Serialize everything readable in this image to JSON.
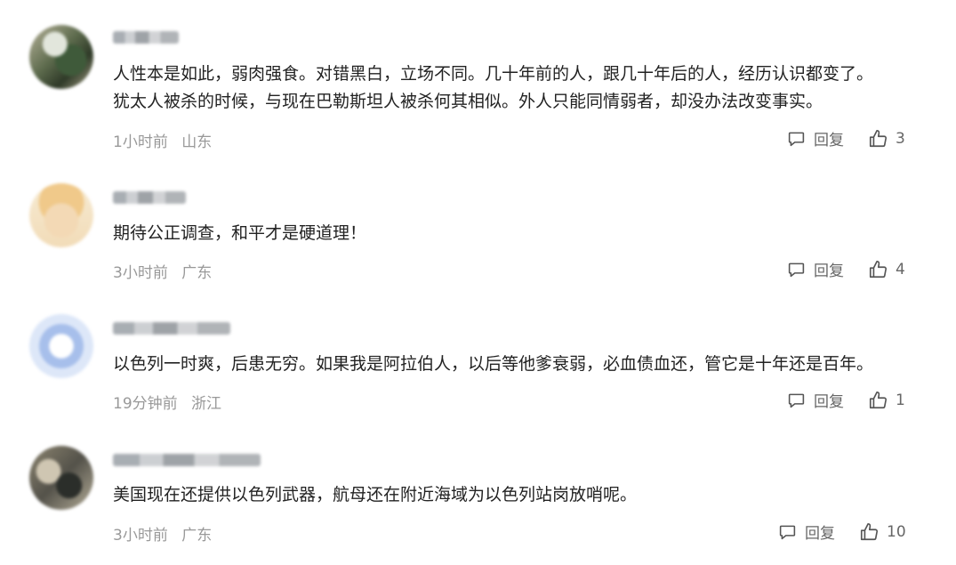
{
  "comments": [
    {
      "text_lines": [
        "人性本是如此，弱肉强食。对错黑白，立场不同。几十年前的人，跟几十年后的人，经历认识都变了。",
        "犹太人被杀的时候，与现在巴勒斯坦人被杀何其相似。外人只能同情弱者，却没办法改变事实。"
      ],
      "time": "1小时前",
      "location": "山东",
      "reply_label": "回复",
      "likes": "3"
    },
    {
      "text_lines": [
        "期待公正调查，和平才是硬道理！"
      ],
      "time": "3小时前",
      "location": "广东",
      "reply_label": "回复",
      "likes": "4"
    },
    {
      "text_lines": [
        "以色列一时爽，后患无穷。如果我是阿拉伯人，以后等他爹衰弱，必血债血还，管它是十年还是百年。"
      ],
      "time": "19分钟前",
      "location": "浙江",
      "reply_label": "回复",
      "likes": "1"
    },
    {
      "text_lines": [
        "美国现在还提供以色列武器，航母还在附近海域为以色列站岗放哨呢。"
      ],
      "time": "3小时前",
      "location": "广东",
      "reply_label": "回复",
      "likes": "10"
    }
  ],
  "icons": {
    "reply": "comment-bubble-icon",
    "like": "thumbs-up-icon"
  },
  "colors": {
    "text": "#222222",
    "meta": "#999999",
    "action": "#666666"
  }
}
